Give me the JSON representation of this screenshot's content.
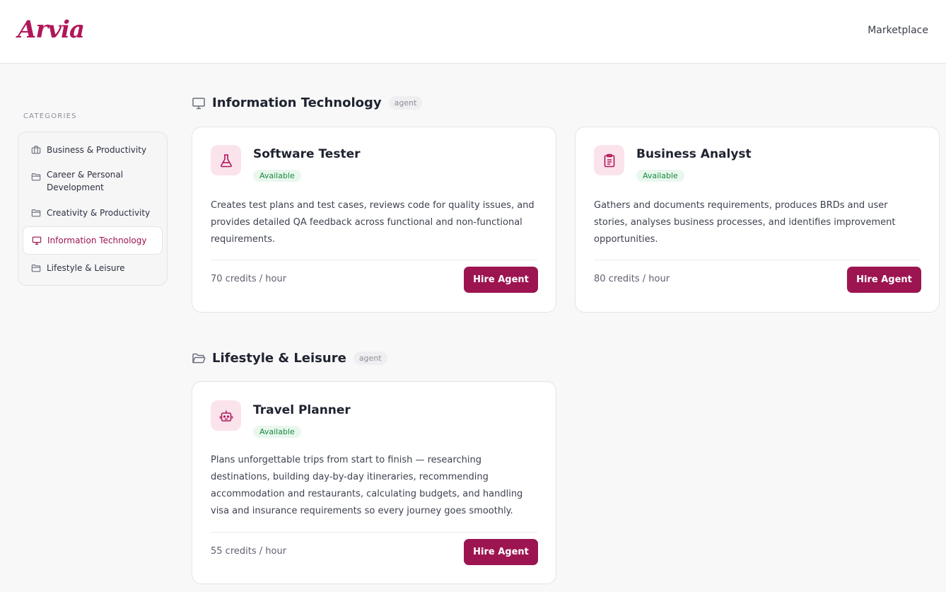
{
  "header": {
    "logo": "Arvia",
    "nav_link": "Marketplace"
  },
  "sidebar": {
    "heading": "CATEGORIES",
    "items": [
      {
        "label": "Business & Productivity",
        "icon": "briefcase-icon"
      },
      {
        "label": "Career & Personal Development",
        "icon": "folder-icon"
      },
      {
        "label": "Creativity & Productivity",
        "icon": "folder-icon"
      },
      {
        "label": "Information Technology",
        "icon": "monitor-icon",
        "active": true
      },
      {
        "label": "Lifestyle & Leisure",
        "icon": "folder-icon"
      }
    ]
  },
  "sections": [
    {
      "title": "Information Technology",
      "tag": "agent",
      "icon": "monitor-icon",
      "cards": [
        {
          "title": "Software Tester",
          "status": "Available",
          "icon": "flask-icon",
          "description": "Creates test plans and test cases, reviews code for quality issues, and provides detailed QA feedback across functional and non-functional requirements.",
          "price": "70 credits / hour",
          "button": "Hire Agent"
        },
        {
          "title": "Business Analyst",
          "status": "Available",
          "icon": "clipboard-icon",
          "description": "Gathers and documents requirements, produces BRDs and user stories, analyses business processes, and identifies improvement opportunities.",
          "price": "80 credits / hour",
          "button": "Hire Agent"
        }
      ]
    },
    {
      "title": "Lifestyle & Leisure",
      "tag": "agent",
      "icon": "folder-open-icon",
      "cards": [
        {
          "title": "Travel Planner",
          "status": "Available",
          "icon": "robot-icon",
          "description": "Plans unforgettable trips from start to finish — researching destinations, building day-by-day itineraries, recommending accommodation and restaurants, calculating budgets, and handling visa and insurance requirements so every journey goes smoothly.",
          "price": "55 credits / hour",
          "button": "Hire Agent"
        }
      ]
    }
  ],
  "colors": {
    "brand": "#9c1550",
    "logo": "#b0175a",
    "icon_bg": "#fbe3ec",
    "available_text": "#178a3c",
    "available_bg": "#e9f7ee"
  }
}
